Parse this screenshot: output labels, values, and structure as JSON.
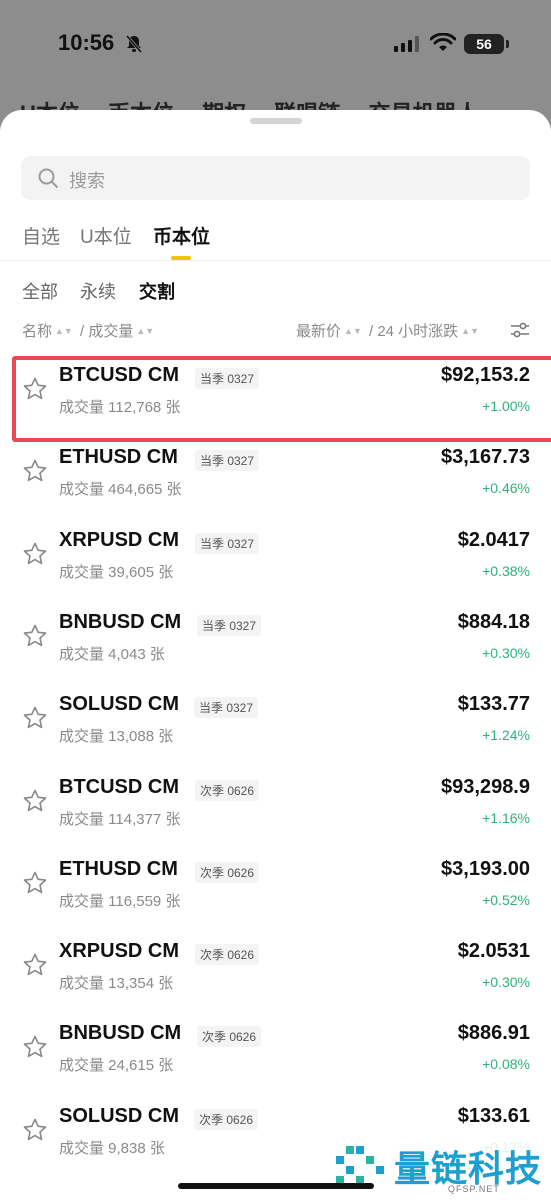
{
  "status": {
    "time": "10:56",
    "battery": "56"
  },
  "background_tabs": [
    "U本位",
    "币本位",
    "期权",
    "联唱链",
    "交易机器人"
  ],
  "search": {
    "placeholder": "搜索"
  },
  "tabs": [
    {
      "label": "自选",
      "active": false
    },
    {
      "label": "U本位",
      "active": false
    },
    {
      "label": "币本位",
      "active": true
    }
  ],
  "subtabs": [
    {
      "label": "全部",
      "active": false
    },
    {
      "label": "永续",
      "active": false
    },
    {
      "label": "交割",
      "active": true
    }
  ],
  "sort": {
    "name": "名称",
    "separator": "/",
    "volume": "成交量",
    "latest_price": "最新价",
    "change_24h": "24 小时涨跌"
  },
  "list": [
    {
      "symbol": "BTCUSD CM",
      "tag": "当季 0327",
      "volume": "成交量 112,768 张",
      "price": "$92,153.2",
      "change": "+1.00%",
      "selected": true
    },
    {
      "symbol": "ETHUSD CM",
      "tag": "当季 0327",
      "volume": "成交量 464,665 张",
      "price": "$3,167.73",
      "change": "+0.46%",
      "selected": false
    },
    {
      "symbol": "XRPUSD CM",
      "tag": "当季 0327",
      "volume": "成交量 39,605 张",
      "price": "$2.0417",
      "change": "+0.38%",
      "selected": false
    },
    {
      "symbol": "BNBUSD CM",
      "tag": "当季 0327",
      "volume": "成交量 4,043 张",
      "price": "$884.18",
      "change": "+0.30%",
      "selected": false
    },
    {
      "symbol": "SOLUSD CM",
      "tag": "当季 0327",
      "volume": "成交量 13,088 张",
      "price": "$133.77",
      "change": "+1.24%",
      "selected": false
    },
    {
      "symbol": "BTCUSD CM",
      "tag": "次季 0626",
      "volume": "成交量 114,377 张",
      "price": "$93,298.9",
      "change": "+1.16%",
      "selected": false
    },
    {
      "symbol": "ETHUSD CM",
      "tag": "次季 0626",
      "volume": "成交量 116,559 张",
      "price": "$3,193.00",
      "change": "+0.52%",
      "selected": false
    },
    {
      "symbol": "XRPUSD CM",
      "tag": "次季 0626",
      "volume": "成交量 13,354 张",
      "price": "$2.0531",
      "change": "+0.30%",
      "selected": false
    },
    {
      "symbol": "BNBUSD CM",
      "tag": "次季 0626",
      "volume": "成交量 24,615 张",
      "price": "$886.91",
      "change": "+0.08%",
      "selected": false
    },
    {
      "symbol": "SOLUSD CM",
      "tag": "次季 0626",
      "volume": "成交量 9,838 张",
      "price": "$133.61",
      "change": "+0.17%",
      "selected": false
    }
  ],
  "watermark": {
    "text": "量链科技",
    "sub": "QFSP.NET"
  },
  "colors": {
    "accent": "#f0c400",
    "positive": "#28b47a",
    "highlight_border": "#e84a55",
    "watermark": "#1d9fd0"
  }
}
